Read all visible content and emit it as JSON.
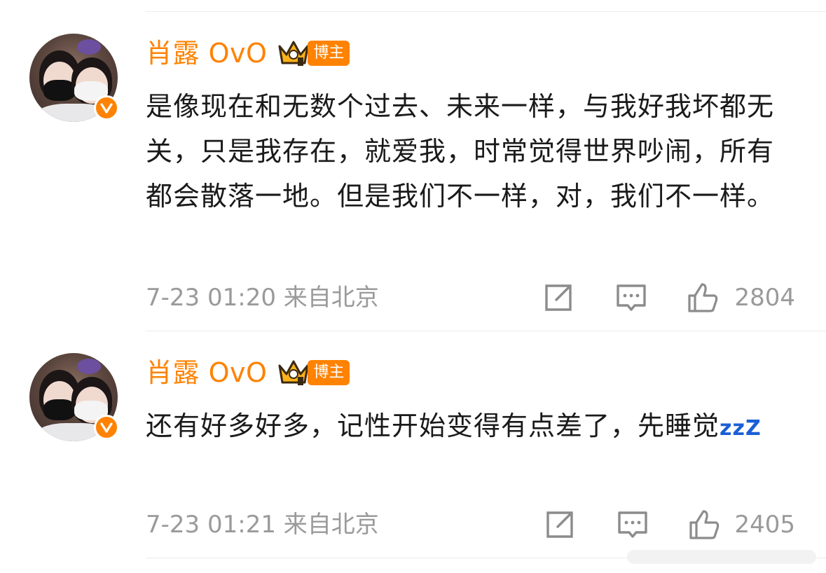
{
  "comments": [
    {
      "username": "肖露 OvO",
      "badge": "博主",
      "text": "是像现在和无数个过去、未来一样，与我好我坏都无关，只是我存在，就爱我，时常觉得世界吵闹，所有都会散落一地。但是我们不一样，对，我们不一样。",
      "time": "7-23 01:20",
      "location": "来自北京",
      "likes": "2804"
    },
    {
      "username": "肖露 OvO",
      "badge": "博主",
      "text": "还有好多好多，记性开始变得有点差了，先睡觉",
      "emoji": "zzZ",
      "time": "7-23 01:21",
      "location": "来自北京",
      "likes": "2405"
    }
  ],
  "icons": [
    "verified-icon",
    "crown-level-icon",
    "share-icon",
    "comment-icon",
    "like-icon"
  ],
  "colors": {
    "accent": "#ff8200",
    "text": "#1a1a1a",
    "meta": "#9a9a9a",
    "divider": "#ececec",
    "zzz": "#1a5fd6"
  }
}
